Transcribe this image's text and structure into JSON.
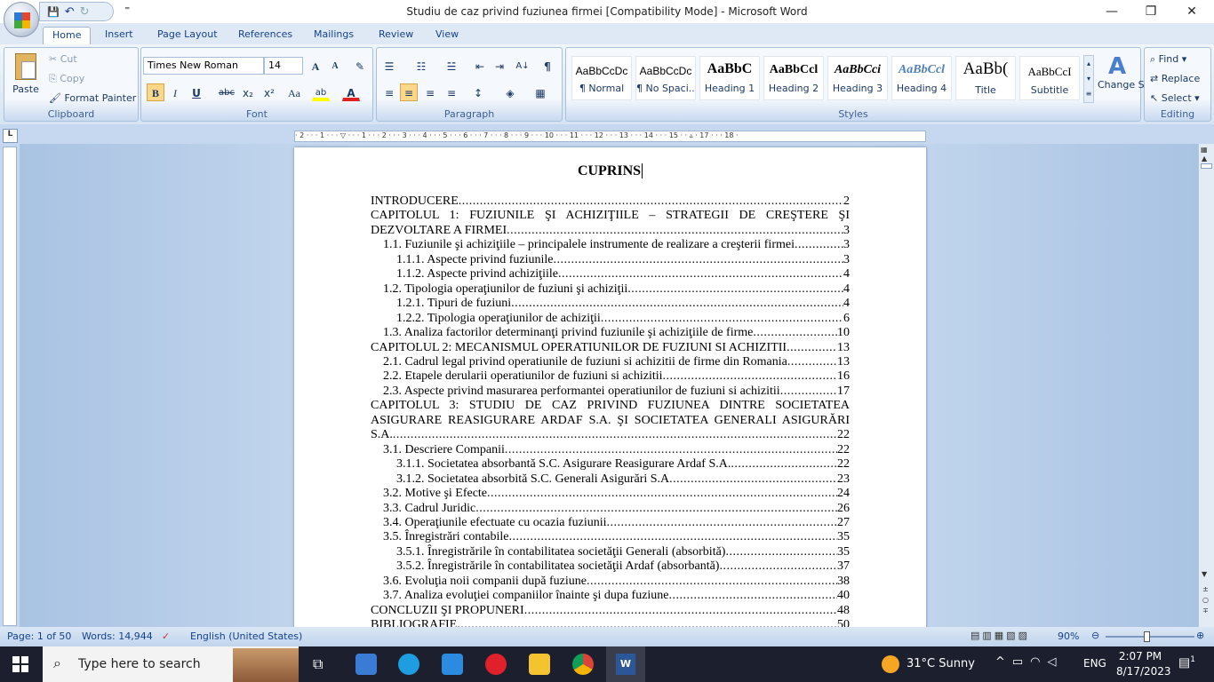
{
  "window": {
    "title": "Studiu de caz privind fuziunea firmei [Compatibility Mode] - Microsoft Word",
    "minimize": "—",
    "maximize": "❐",
    "close": "✕"
  },
  "qat": {
    "save": "💾",
    "undo": "↶",
    "redo": "↻",
    "customize": "⁼"
  },
  "tabs": [
    "Home",
    "Insert",
    "Page Layout",
    "References",
    "Mailings",
    "Review",
    "View"
  ],
  "clipboard": {
    "paste": "Paste",
    "cut": "Cut",
    "copy": "Copy",
    "format_painter": "Format Painter",
    "label": "Clipboard"
  },
  "font": {
    "name": "Times New Roman",
    "size": "14",
    "label": "Font",
    "grow": "A",
    "shrink": "A",
    "clear": "✎",
    "bold": "B",
    "italic": "I",
    "underline": "U",
    "strike": "abc",
    "subscript": "x₂",
    "superscript": "x²",
    "case": "Aa",
    "highlight": "ab",
    "color": "A"
  },
  "paragraph": {
    "label": "Paragraph",
    "bullets": "☰",
    "numbering": "☷",
    "multilevel": "☱",
    "dec_indent": "⇤",
    "inc_indent": "⇥",
    "sort": "A↓",
    "pilcrow": "¶",
    "align_left": "≡",
    "center": "≡",
    "align_right": "≡",
    "justify": "≡",
    "spacing": "↕",
    "shading": "◈",
    "borders": "▦"
  },
  "styles": {
    "label": "Styles",
    "items": [
      {
        "sample": "AaBbCcDc",
        "name": "¶ Normal"
      },
      {
        "sample": "AaBbCcDc",
        "name": "¶ No Spaci..."
      },
      {
        "sample": "AaBbC",
        "name": "Heading 1"
      },
      {
        "sample": "AaBbCcl",
        "name": "Heading 2"
      },
      {
        "sample": "AaBbCci",
        "name": "Heading 3"
      },
      {
        "sample": "AaBbCcl",
        "name": "Heading 4"
      },
      {
        "sample": "AaBb(",
        "name": "Title"
      },
      {
        "sample": "AaBbCcI",
        "name": "Subtitle"
      }
    ],
    "change": "Change Styles"
  },
  "editing": {
    "label": "Editing",
    "find": "Find",
    "replace": "Replace",
    "select": "Select"
  },
  "ruler": {
    "ticks": "· 2 · · · 1 · · · ▽ · · · 1 · · · 2 · · · 3 · · · 4 · · · 5 · · · 6 · · · 7 · · · 8 · · · 9 · · · 10 · · · 11 · · · 12 · · · 13 · · · 14 · · · 15 · · ▵ · 17 · · · 18 ·"
  },
  "document": {
    "title": "CUPRINS",
    "toc": [
      {
        "level": 1,
        "text": "INTRODUCERE",
        "page": "2"
      },
      {
        "level": 1,
        "lead": "CAPITOLUL 1: FUZIUNILE ŞI ACHIZIŢIILE – STRATEGII DE CREŞTERE ŞI",
        "text": "DEZVOLTARE A FIRMEI",
        "page": "3"
      },
      {
        "level": 2,
        "text": "1.1. Fuziunile şi achiziţiile – principalele instrumente de realizare a creşterii  firmei ",
        "page": "3"
      },
      {
        "level": 3,
        "text": "1.1.1. Aspecte privind fuziunile",
        "page": "3"
      },
      {
        "level": 3,
        "text": "1.1.2. Aspecte privind achiziţiile ",
        "page": "4"
      },
      {
        "level": 2,
        "text": "1.2. Tipologia operaţiunilor de fuziuni şi achiziţii ",
        "page": "4"
      },
      {
        "level": 3,
        "text": "1.2.1. Tipuri de fuziuni",
        "page": "4"
      },
      {
        "level": 3,
        "text": "1.2.2. Tipologia operaţiunilor de achiziţii ",
        "page": "6"
      },
      {
        "level": 2,
        "text": "1.3. Analiza factorilor determinanţi privind fuziunile şi achiziţiile de firme",
        "page": "10"
      },
      {
        "level": 1,
        "text": "CAPITOLUL 2: MECANISMUL OPERATIUNILOR DE FUZIUNI SI ACHIZITII",
        "page": "13"
      },
      {
        "level": 2,
        "text": "2.1. Cadrul legal privind operatiunile de fuziuni si achizitii de firme din Romania ",
        "page": "13"
      },
      {
        "level": 2,
        "text": "2.2. Etapele derularii operatiunilor de fuziuni si achizitii ",
        "page": "16"
      },
      {
        "level": 2,
        "text": "2.3. Aspecte privind masurarea performantei operatiunilor de fuziuni si achizitii ",
        "page": "17"
      },
      {
        "level": 1,
        "lead": "CAPITOLUL 3: STUDIU DE CAZ PRIVIND FUZIUNEA DINTRE SOCIETATEA",
        "lead2": "ASIGURARE REASIGURARE ARDAF S.A. ŞI SOCIETATEA GENERALI ASIGURĂRI",
        "text": "S.A.",
        "page": "22"
      },
      {
        "level": 2,
        "text": "3.1. Descriere Companii",
        "page": "22"
      },
      {
        "level": 3,
        "text": "3.1.1. Societatea absorbantă S.C. Asigurare Reasigurare Ardaf S.A. ",
        "page": "22"
      },
      {
        "level": 3,
        "text": "3.1.2. Societatea absorbită S.C. Generali Asigurări S.A ",
        "page": "23"
      },
      {
        "level": 2,
        "text": "3.2. Motive şi Efecte",
        "page": "24"
      },
      {
        "level": 2,
        "text": "3.3. Cadrul Juridic",
        "page": "26"
      },
      {
        "level": 2,
        "text": "3.4. Operaţiunile efectuate cu ocazia fuziunii ",
        "page": "27"
      },
      {
        "level": 2,
        "text": "3.5. Înregistrări contabile",
        "page": "35"
      },
      {
        "level": 3,
        "text": "3.5.1. Înregistrările în contabilitatea societăţii Generali (absorbită) ",
        "page": "35"
      },
      {
        "level": 3,
        "text": "3.5.2. Înregistrările în contabilitatea societăţii Ardaf (absorbantă)",
        "page": "37"
      },
      {
        "level": 2,
        "text": "3.6. Evoluţia noii companii după fuziune ",
        "page": "38"
      },
      {
        "level": 2,
        "text": "3.7. Analiza evoluţiei companiilor înainte şi dupa fuziune ",
        "page": "40"
      },
      {
        "level": 1,
        "text": "CONCLUZII ŞI PROPUNERI ",
        "page": "48"
      },
      {
        "level": 1,
        "text": "BIBLIOGRAFIE",
        "page": "50"
      }
    ]
  },
  "status": {
    "page": "Page: 1 of 50",
    "words": "Words: 14,944",
    "language": "English (United States)",
    "zoom": "90%",
    "zoom_fraction": 0.9
  },
  "taskbar": {
    "search_placeholder": "Type here to search",
    "weather": "31°C  Sunny",
    "lang": "ENG",
    "time": "2:07 PM",
    "date": "8/17/2023",
    "notif_count": "1"
  },
  "colors": {
    "accent": "#15428b",
    "ribbon": "#dfe9f5",
    "taskbar": "#1c1f2e"
  }
}
